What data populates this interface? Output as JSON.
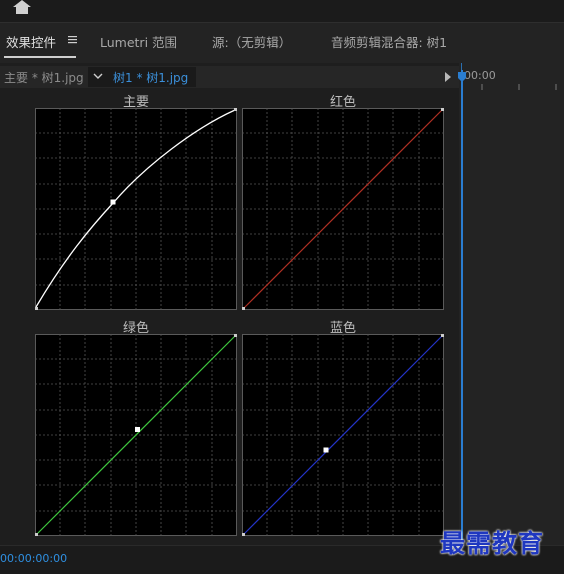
{
  "tabs": [
    {
      "label": "效果控件",
      "active": true
    },
    {
      "label": "Lumetri 范围",
      "active": false
    },
    {
      "label": "源:（无剪辑）",
      "active": false
    },
    {
      "label": "音频剪辑混合器: 树1",
      "active": false
    }
  ],
  "source": {
    "main_label": "主要 * 树1.jpg",
    "clip_label": "树1 * 树1.jpg"
  },
  "timeline": {
    "top_timecode": "00:00",
    "bottom_timecode": "00:00:00:00"
  },
  "curves": {
    "master": {
      "label": "主要",
      "color": "#ffffff"
    },
    "red": {
      "label": "红色",
      "color": "#b03024"
    },
    "green": {
      "label": "绿色",
      "color": "#3fc73f"
    },
    "blue": {
      "label": "蓝色",
      "color": "#2434c8"
    }
  },
  "watermark": "最需教育"
}
